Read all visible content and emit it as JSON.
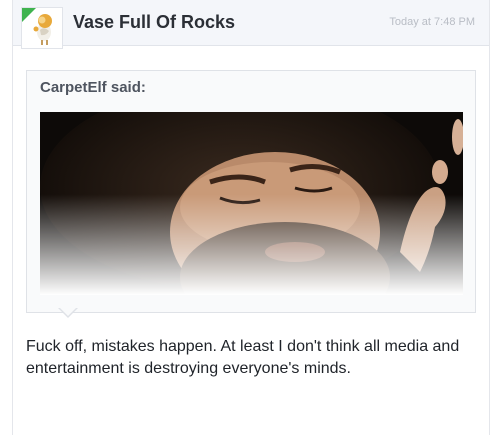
{
  "post": {
    "author": "Vase Full Of Rocks",
    "timestamp": "Today at 7:48 PM",
    "avatar_icon": "cartoon-character-avatar",
    "online_indicator_color": "#3fb34f",
    "quote": {
      "author_label": "CarpetElf said:",
      "media_icon": "reaction-gif-thumbnail"
    },
    "message": "Fuck off, mistakes happen. At least I don't think all media and entertainment is destroying everyone's minds."
  }
}
